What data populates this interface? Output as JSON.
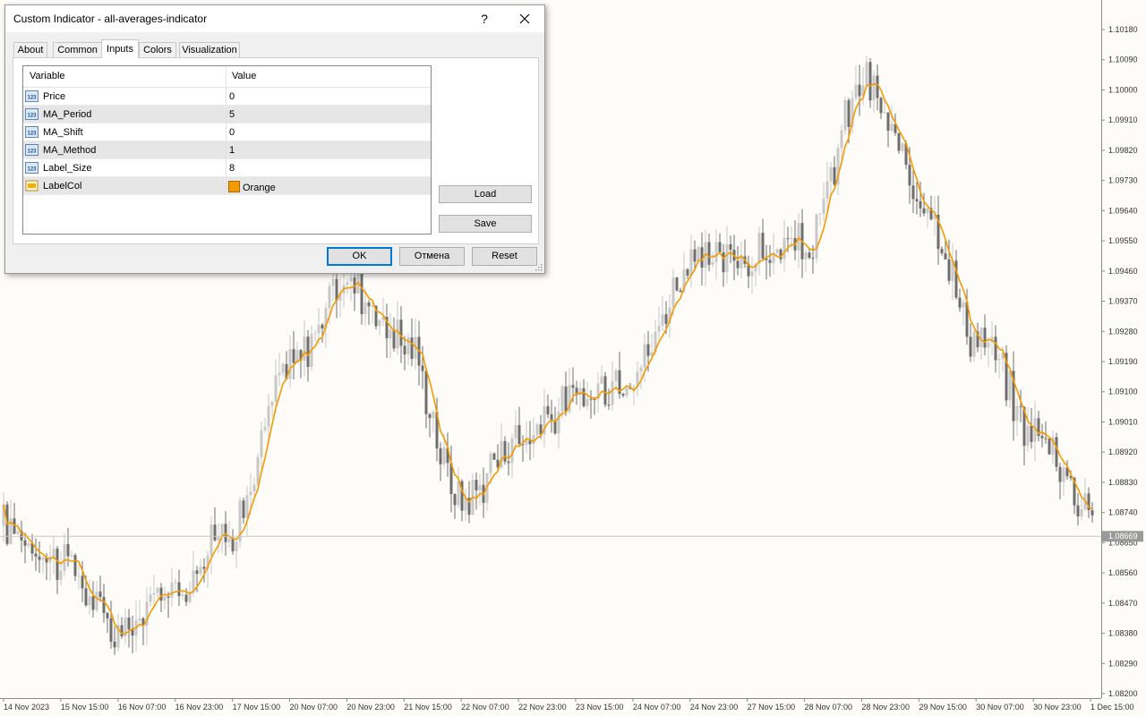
{
  "dialog": {
    "title": "Custom Indicator - all-averages-indicator",
    "help_label": "?",
    "tabs": [
      "About",
      "Common",
      "Inputs",
      "Colors",
      "Visualization"
    ],
    "active_tab": "Inputs",
    "grid": {
      "headers": [
        "Variable",
        "Value"
      ],
      "rows": [
        {
          "name": "Price",
          "value": "0",
          "icon": "numeric-icon"
        },
        {
          "name": "MA_Period",
          "value": "5",
          "icon": "numeric-icon"
        },
        {
          "name": "MA_Shift",
          "value": "0",
          "icon": "numeric-icon"
        },
        {
          "name": "MA_Method",
          "value": "1",
          "icon": "numeric-icon"
        },
        {
          "name": "Label_Size",
          "value": "8",
          "icon": "numeric-icon"
        },
        {
          "name": "LabelCol",
          "value": "Orange",
          "icon": "color-icon"
        }
      ]
    },
    "buttons": {
      "load": "Load",
      "save": "Save",
      "ok": "OK",
      "cancel": "Отмена",
      "reset": "Reset"
    }
  },
  "colors": {
    "ma_line": "#f59a00",
    "bull_candle": "#c8c8c8",
    "bear_candle": "#6e6e6e",
    "background": "#fdfcf8"
  },
  "chart": {
    "current_price": "1.08669",
    "price_labels": [
      "1.10180",
      "1.10090",
      "1.10000",
      "1.09910",
      "1.09820",
      "1.09730",
      "1.09640",
      "1.09550",
      "1.09460",
      "1.09370",
      "1.09280",
      "1.09190",
      "1.09100",
      "1.09010",
      "1.08920",
      "1.08830",
      "1.08740",
      "1.08650",
      "1.08560",
      "1.08470",
      "1.08380",
      "1.08290",
      "1.08200"
    ],
    "time_labels": [
      "14 Nov 2023",
      "15 Nov 15:00",
      "16 Nov 07:00",
      "16 Nov 23:00",
      "17 Nov 15:00",
      "20 Nov 07:00",
      "20 Nov 23:00",
      "21 Nov 15:00",
      "22 Nov 07:00",
      "22 Nov 23:00",
      "23 Nov 15:00",
      "24 Nov 07:00",
      "24 Nov 23:00",
      "27 Nov 15:00",
      "28 Nov 07:00",
      "28 Nov 23:00",
      "29 Nov 15:00",
      "30 Nov 07:00",
      "30 Nov 23:00",
      "1 Dec 15:00"
    ]
  },
  "chart_data": {
    "type": "line",
    "x": [
      "14 Nov 2023",
      "15 Nov 15:00",
      "16 Nov 07:00",
      "16 Nov 23:00",
      "17 Nov 15:00",
      "20 Nov 07:00",
      "20 Nov 23:00",
      "21 Nov 15:00",
      "22 Nov 07:00",
      "22 Nov 23:00",
      "23 Nov 15:00",
      "24 Nov 07:00",
      "24 Nov 23:00",
      "27 Nov 15:00",
      "28 Nov 07:00",
      "28 Nov 23:00",
      "29 Nov 15:00",
      "30 Nov 07:00",
      "30 Nov 23:00",
      "1 Dec 15:00"
    ],
    "series": [
      {
        "values": [
          1.087,
          1.086,
          1.0838,
          1.0852,
          1.087,
          1.0918,
          1.0943,
          1.0925,
          1.0878,
          1.0897,
          1.0907,
          1.0917,
          1.0948,
          1.095,
          1.0953,
          1.1002,
          1.097,
          1.0926,
          1.0898,
          1.0876
        ]
      }
    ],
    "ylim": [
      1.082,
      1.1018
    ],
    "legend": "none",
    "grid": false
  }
}
